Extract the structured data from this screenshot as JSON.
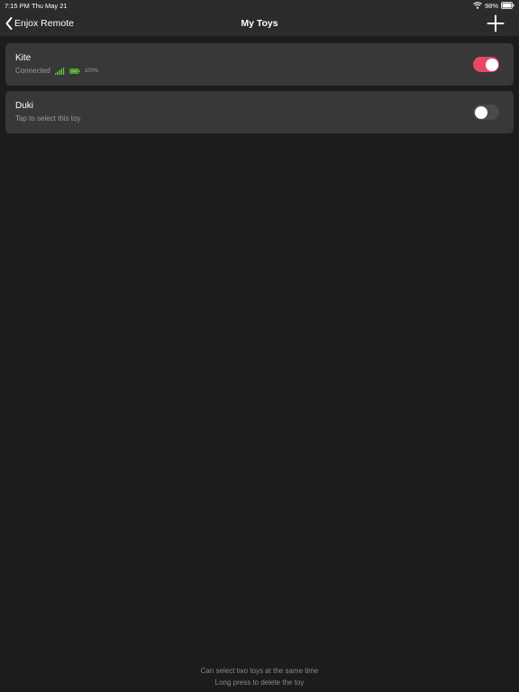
{
  "status_bar": {
    "time": "7:15 PM",
    "date": "Thu May 21",
    "battery": "98%",
    "icons": [
      "wifi-icon",
      "battery-icon"
    ]
  },
  "nav": {
    "back_label": "Enjox Remote",
    "title": "My Toys",
    "icons": [
      "chevron-left-icon",
      "plus-icon"
    ]
  },
  "toys": [
    {
      "name": "Kite",
      "status": "Connected",
      "battery": "100%",
      "enabled": true,
      "icons": [
        "signal-bars-icon",
        "battery-icon"
      ]
    },
    {
      "name": "Duki",
      "status": "Tap to select this toy",
      "enabled": false
    }
  ],
  "footer": {
    "line1": "Can select two toys at the same time",
    "line2": "Long press to delete the toy"
  },
  "colors": {
    "background": "#1c1c1c",
    "bar": "#2b2b2b",
    "card": "#383838",
    "toggle_on": "#e8466b",
    "toggle_off": "#4a4a4a",
    "connected_green": "#5fbf3a"
  }
}
